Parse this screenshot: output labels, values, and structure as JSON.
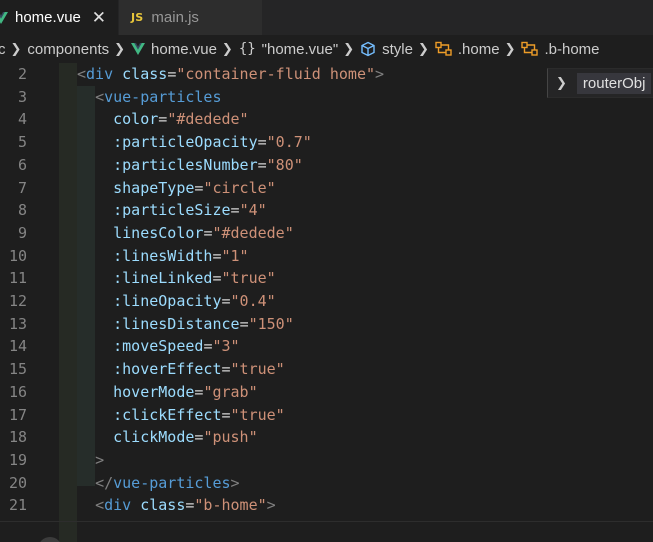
{
  "tabs": [
    {
      "label": "home.vue",
      "icon": "vue-icon",
      "active": true,
      "close": "✕"
    },
    {
      "label": "main.js",
      "icon": "js-icon",
      "icon_text": "JS",
      "active": false
    }
  ],
  "breadcrumb": {
    "items": [
      "rc",
      "components",
      "home.vue",
      "\"home.vue\"",
      "style",
      ".home",
      ".b-home"
    ],
    "braces": "{}"
  },
  "popup": {
    "label": "routerObj"
  },
  "colors": {
    "vue_green": "#41b883",
    "tag": "#569cd6",
    "attr": "#9cdcfe",
    "string": "#ce9178",
    "bracket": "#808080"
  },
  "editor": {
    "line_numbers": [
      "2",
      "3",
      "4",
      "5",
      "6",
      "7",
      "8",
      "9",
      "10",
      "11",
      "12",
      "13",
      "14",
      "15",
      "16",
      "17",
      "18",
      "19",
      "20",
      "21"
    ],
    "lines": [
      {
        "indent": "",
        "pre": "<",
        "tag": "div",
        "attr": " class",
        "eq": "=",
        "val": "\"container-fluid home\"",
        "post": ">"
      },
      {
        "indent": "  ",
        "pre": "<",
        "tag": "vue-particles",
        "attr": "",
        "eq": "",
        "val": "",
        "post": ""
      },
      {
        "indent": "    ",
        "pre": "",
        "tag": "",
        "attr": "color",
        "eq": "=",
        "val": "\"#dedede\"",
        "post": ""
      },
      {
        "indent": "    ",
        "pre": "",
        "tag": "",
        "attr": ":particleOpacity",
        "eq": "=",
        "val": "\"0.7\"",
        "post": ""
      },
      {
        "indent": "    ",
        "pre": "",
        "tag": "",
        "attr": ":particlesNumber",
        "eq": "=",
        "val": "\"80\"",
        "post": ""
      },
      {
        "indent": "    ",
        "pre": "",
        "tag": "",
        "attr": "shapeType",
        "eq": "=",
        "val": "\"circle\"",
        "post": ""
      },
      {
        "indent": "    ",
        "pre": "",
        "tag": "",
        "attr": ":particleSize",
        "eq": "=",
        "val": "\"4\"",
        "post": ""
      },
      {
        "indent": "    ",
        "pre": "",
        "tag": "",
        "attr": "linesColor",
        "eq": "=",
        "val": "\"#dedede\"",
        "post": ""
      },
      {
        "indent": "    ",
        "pre": "",
        "tag": "",
        "attr": ":linesWidth",
        "eq": "=",
        "val": "\"1\"",
        "post": ""
      },
      {
        "indent": "    ",
        "pre": "",
        "tag": "",
        "attr": ":lineLinked",
        "eq": "=",
        "val": "\"true\"",
        "post": ""
      },
      {
        "indent": "    ",
        "pre": "",
        "tag": "",
        "attr": ":lineOpacity",
        "eq": "=",
        "val": "\"0.4\"",
        "post": ""
      },
      {
        "indent": "    ",
        "pre": "",
        "tag": "",
        "attr": ":linesDistance",
        "eq": "=",
        "val": "\"150\"",
        "post": ""
      },
      {
        "indent": "    ",
        "pre": "",
        "tag": "",
        "attr": ":moveSpeed",
        "eq": "=",
        "val": "\"3\"",
        "post": ""
      },
      {
        "indent": "    ",
        "pre": "",
        "tag": "",
        "attr": ":hoverEffect",
        "eq": "=",
        "val": "\"true\"",
        "post": ""
      },
      {
        "indent": "    ",
        "pre": "",
        "tag": "",
        "attr": "hoverMode",
        "eq": "=",
        "val": "\"grab\"",
        "post": ""
      },
      {
        "indent": "    ",
        "pre": "",
        "tag": "",
        "attr": ":clickEffect",
        "eq": "=",
        "val": "\"true\"",
        "post": ""
      },
      {
        "indent": "    ",
        "pre": "",
        "tag": "",
        "attr": "clickMode",
        "eq": "=",
        "val": "\"push\"",
        "post": ""
      },
      {
        "indent": "  ",
        "pre": ">",
        "tag": "",
        "attr": "",
        "eq": "",
        "val": "",
        "post": ""
      },
      {
        "indent": "  ",
        "pre": "</",
        "tag": "vue-particles",
        "attr": "",
        "eq": "",
        "val": "",
        "post": ">"
      },
      {
        "indent": "  ",
        "pre": "<",
        "tag": "div",
        "attr": " class",
        "eq": "=",
        "val": "\"b-home\"",
        "post": ">"
      }
    ]
  }
}
